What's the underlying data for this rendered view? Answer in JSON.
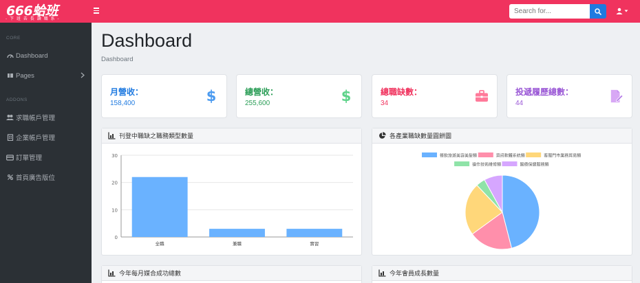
{
  "brand": {
    "name": "666蛤班",
    "tagline": "- 下 班 去 長 讀 職 系 -"
  },
  "search": {
    "placeholder": "Search for..."
  },
  "sidebar": {
    "core_heading": "CORE",
    "addons_heading": "ADDONS",
    "items": [
      {
        "label": "Dashboard",
        "icon": "dashboard-icon"
      },
      {
        "label": "Pages",
        "icon": "pages-icon"
      },
      {
        "label": "求職帳戶管理",
        "icon": "users-icon"
      },
      {
        "label": "企業帳戶管理",
        "icon": "building-icon"
      },
      {
        "label": "訂單管理",
        "icon": "card-icon"
      },
      {
        "label": "首頁廣告版位",
        "icon": "ad-icon"
      }
    ]
  },
  "main": {
    "title": "Dashboard",
    "breadcrumb": "Dashboard"
  },
  "cards": [
    {
      "label": "月營收：",
      "value": "158,400",
      "color": "#1f7ae0",
      "icon": "dollar-icon"
    },
    {
      "label": "總營收：",
      "value": "255,600",
      "color": "#2a9d56",
      "icon": "dollar-icon"
    },
    {
      "label": "總職缺數：",
      "value": "34",
      "color": "#f0335e",
      "icon": "briefcase-icon"
    },
    {
      "label": "投遞履歷總數：",
      "value": "44",
      "color": "#9b59d6",
      "icon": "file-edit-icon"
    }
  ],
  "panels": {
    "bar_title": "刊登中職缺之職務類型數量",
    "pie_title": "各產業職缺數量圓餅圖",
    "monthly_title": "今年每月媒合成功總數",
    "members_title": "今年會員成長數量"
  },
  "chart_data": [
    {
      "type": "bar",
      "categories": [
        "全職",
        "兼職",
        "實習"
      ],
      "values": [
        22,
        3,
        3
      ],
      "ylim": [
        0,
        30
      ],
      "yticks": [
        0,
        10,
        20,
        30
      ],
      "color": "#6ab2ff",
      "grid": true
    },
    {
      "type": "pie",
      "legend_position": "top",
      "slices": [
        {
          "label": "餐飲旅遊美容美髮類",
          "value": 46,
          "color": "#6ab2ff"
        },
        {
          "label": "資訊軟體系統類",
          "value": 19,
          "color": "#ff8fab"
        },
        {
          "label": "客服門市業務貿易類",
          "value": 23,
          "color": "#ffd77a"
        },
        {
          "label": "操作技術維修類",
          "value": 4,
          "color": "#8fe3a8"
        },
        {
          "label": "醫療保健服務類",
          "value": 8,
          "color": "#d6a6ff"
        }
      ]
    }
  ]
}
